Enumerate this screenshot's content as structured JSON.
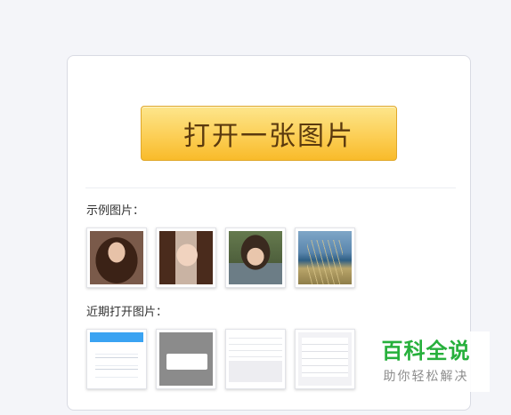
{
  "card": {
    "open_button_label": "打开一张图片",
    "samples_label": "示例图片：",
    "recent_label": "近期打开图片："
  },
  "samples": [
    {
      "icon": "photo-woman-portrait"
    },
    {
      "icon": "photo-woman-smiling"
    },
    {
      "icon": "photo-child-portrait"
    },
    {
      "icon": "photo-sea-grass"
    }
  ],
  "recent": [
    {
      "icon": "screenshot-app-chat"
    },
    {
      "icon": "screenshot-dialog"
    },
    {
      "icon": "screenshot-settings-list"
    },
    {
      "icon": "screenshot-text-list"
    }
  ],
  "watermark": {
    "title": "百科全说",
    "subtitle": "助你轻松解决"
  },
  "colors": {
    "button_gradient_top": "#fde68c",
    "button_gradient_bottom": "#f9bb2a",
    "button_text": "#5b3a0e",
    "watermark_green": "#27b03c"
  }
}
